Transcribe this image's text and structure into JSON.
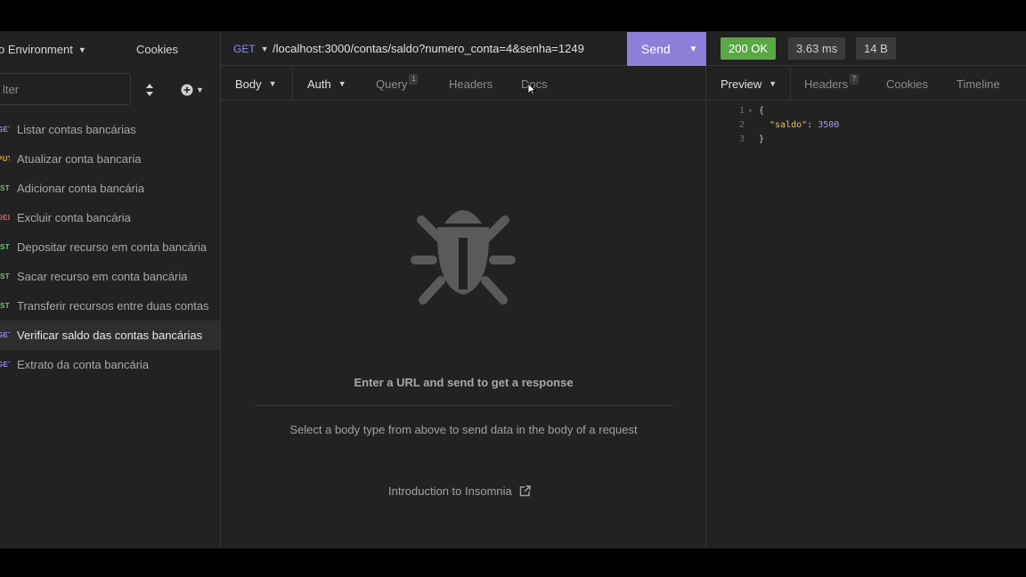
{
  "sidebar": {
    "environment_label": "o Environment",
    "cookies_label": "Cookies",
    "filter_placeholder": "lter",
    "requests": [
      {
        "method": "GET",
        "label": "Listar contas bancárias"
      },
      {
        "method": "PUT",
        "label": "Atualizar conta bancaria"
      },
      {
        "method": "POST",
        "label": "Adicionar conta bancária"
      },
      {
        "method": "DEL",
        "label": "Excluir conta bancária"
      },
      {
        "method": "POST",
        "label": "Depositar recurso em conta bancária"
      },
      {
        "method": "POST",
        "label": "Sacar recurso em conta bancária"
      },
      {
        "method": "POST",
        "label": "Transferir recursos entre duas contas"
      },
      {
        "method": "GET",
        "label": "Verificar saldo das contas bancárias"
      },
      {
        "method": "GET",
        "label": "Extrato da conta bancária"
      }
    ]
  },
  "request": {
    "method": "GET",
    "url": "/localhost:3000/contas/saldo?numero_conta=4&senha=1249",
    "send_label": "Send",
    "tabs": {
      "body": "Body",
      "auth": "Auth",
      "query": "Query",
      "query_badge": "1",
      "headers": "Headers",
      "docs": "Docs"
    },
    "empty_title": "Enter a URL and send to get a response",
    "empty_hint": "Select a body type from above to send data in the body of a request",
    "intro_link": "Introduction to Insomnia"
  },
  "response": {
    "status": "200 OK",
    "time": "3.63 ms",
    "size": "14 B",
    "tabs": {
      "preview": "Preview",
      "headers": "Headers",
      "headers_badge": "7",
      "cookies": "Cookies",
      "timeline": "Timeline"
    },
    "body_lines": [
      {
        "n": "1",
        "text": "{"
      },
      {
        "n": "2",
        "key": "\"saldo\"",
        "value": "3500"
      },
      {
        "n": "3",
        "text": "}"
      }
    ]
  },
  "colors": {
    "accent": "#8b7fd9",
    "ok": "#5aa845",
    "background": "#222222"
  }
}
